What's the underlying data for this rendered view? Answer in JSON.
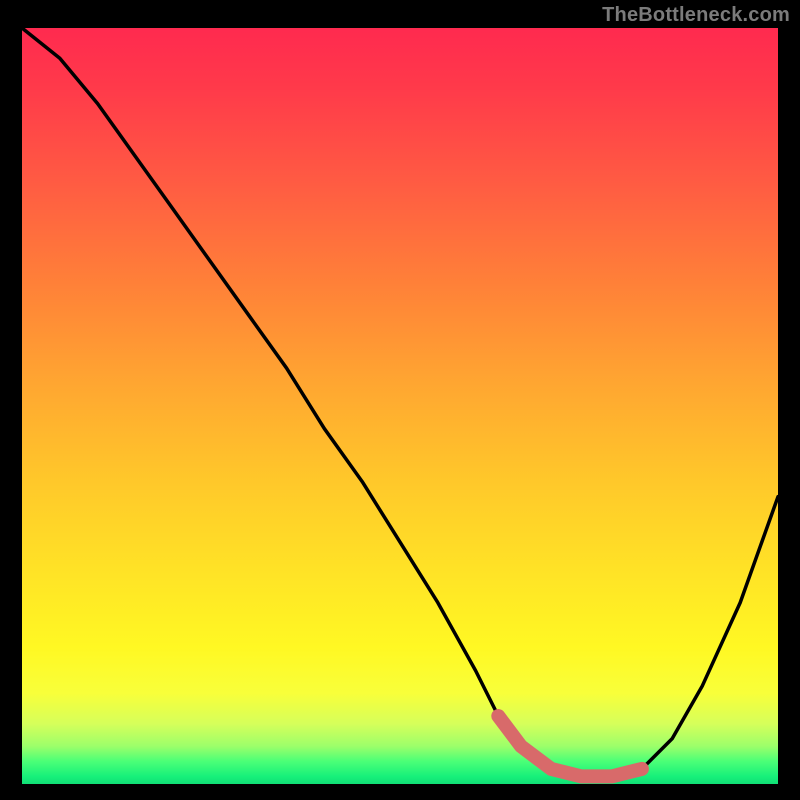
{
  "watermark": "TheBottleneck.com",
  "chart_data": {
    "type": "line",
    "title": "",
    "xlabel": "",
    "ylabel": "",
    "xlim": [
      0,
      100
    ],
    "ylim": [
      0,
      100
    ],
    "series": [
      {
        "name": "main-curve",
        "color": "#000000",
        "x": [
          0,
          5,
          10,
          15,
          20,
          25,
          30,
          35,
          40,
          45,
          50,
          55,
          60,
          63,
          66,
          70,
          74,
          78,
          82,
          86,
          90,
          95,
          100
        ],
        "values": [
          100,
          96,
          90,
          83,
          76,
          69,
          62,
          55,
          47,
          40,
          32,
          24,
          15,
          9,
          5,
          2,
          1,
          1,
          2,
          6,
          13,
          24,
          38
        ]
      },
      {
        "name": "highlight-segment",
        "color": "#d86a6a",
        "x": [
          63,
          66,
          70,
          74,
          78,
          82
        ],
        "values": [
          9,
          5,
          2,
          1,
          1,
          2
        ]
      }
    ],
    "gradient_stops": [
      {
        "pos": 0,
        "color": "#ff2a4f"
      },
      {
        "pos": 50,
        "color": "#ffb02e"
      },
      {
        "pos": 80,
        "color": "#fff823"
      },
      {
        "pos": 100,
        "color": "#11df76"
      }
    ]
  }
}
